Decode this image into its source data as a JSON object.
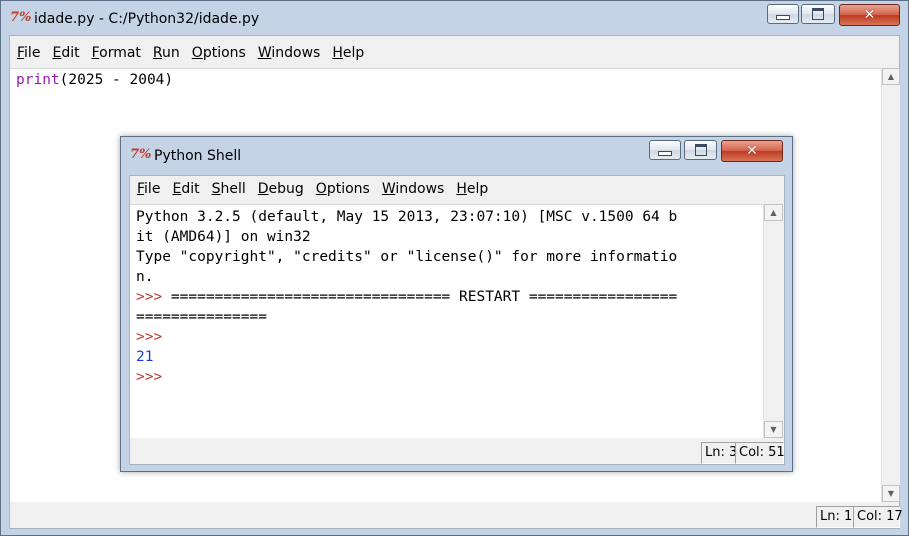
{
  "editor_window": {
    "title": "idade.py - C:/Python32/idade.py",
    "icon": "7%",
    "menu": [
      {
        "label": "File",
        "ul": "F",
        "rest": "ile"
      },
      {
        "label": "Edit",
        "ul": "E",
        "rest": "dit"
      },
      {
        "label": "Format",
        "ul": "F",
        "rest": "ormat"
      },
      {
        "label": "Run",
        "ul": "R",
        "rest": "un"
      },
      {
        "label": "Options",
        "ul": "O",
        "rest": "ptions"
      },
      {
        "label": "Windows",
        "ul": "W",
        "rest": "indows"
      },
      {
        "label": "Help",
        "ul": "H",
        "rest": "elp"
      }
    ],
    "code": {
      "keyword": "print",
      "rest": "(2025 - 2004)"
    },
    "status": {
      "ln": "Ln: 1",
      "col": "Col: 17"
    }
  },
  "shell_window": {
    "title": "Python Shell",
    "icon": "7%",
    "menu": [
      {
        "label": "File",
        "ul": "F",
        "rest": "ile"
      },
      {
        "label": "Edit",
        "ul": "E",
        "rest": "dit"
      },
      {
        "label": "Shell",
        "ul": "S",
        "pre": "",
        "rest": "hell"
      },
      {
        "label": "Debug",
        "ul": "D",
        "rest": "ebug"
      },
      {
        "label": "Options",
        "ul": "O",
        "rest": "ptions"
      },
      {
        "label": "Windows",
        "ul": "W",
        "rest": "indows"
      },
      {
        "label": "Help",
        "ul": "H",
        "rest": "elp"
      }
    ],
    "lines": [
      {
        "parts": [
          {
            "cls": "plain",
            "text": "Python 3.2.5 (default, May 15 2013, 23:07:10) [MSC v.1500 64 b"
          }
        ]
      },
      {
        "parts": [
          {
            "cls": "plain",
            "text": "it (AMD64)] on win32"
          }
        ]
      },
      {
        "parts": [
          {
            "cls": "plain",
            "text": "Type \"copyright\", \"credits\" or \"license()\" for more informatio"
          }
        ]
      },
      {
        "parts": [
          {
            "cls": "plain",
            "text": "n."
          }
        ]
      },
      {
        "parts": [
          {
            "cls": "prompt",
            "text": ">>> "
          },
          {
            "cls": "plain",
            "text": "================================ RESTART ================="
          }
        ]
      },
      {
        "parts": [
          {
            "cls": "plain",
            "text": "==============="
          }
        ]
      },
      {
        "parts": [
          {
            "cls": "prompt",
            "text": ">>>"
          }
        ]
      },
      {
        "parts": [
          {
            "cls": "out",
            "text": "21"
          }
        ]
      },
      {
        "parts": [
          {
            "cls": "prompt",
            "text": ">>>"
          }
        ]
      }
    ],
    "status": {
      "ln": "Ln: 3",
      "col": "Col: 51"
    }
  },
  "colors": {
    "keyword": "#9a1ab0",
    "prompt": "#c0392b",
    "output": "#1a3bd4"
  }
}
